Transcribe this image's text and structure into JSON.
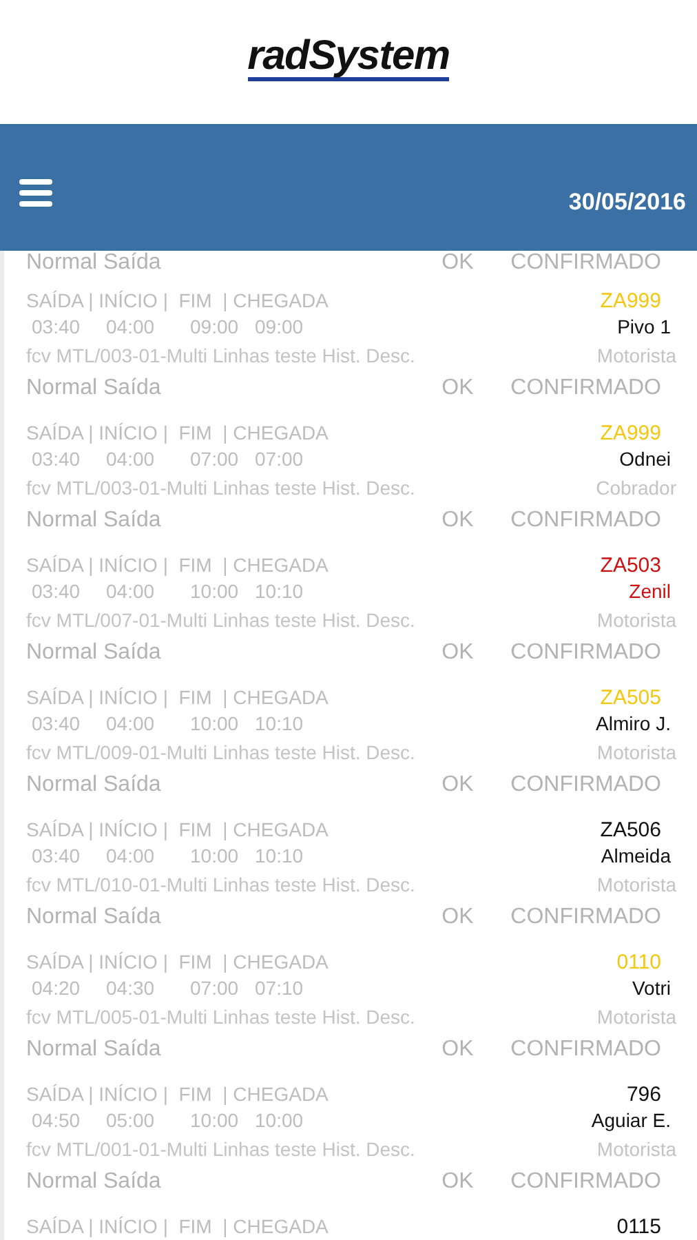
{
  "logo": {
    "text": "radSystem"
  },
  "toolbar": {
    "date": "30/05/2016"
  },
  "trips": [
    {
      "status": "Normal Saída",
      "result": "OK",
      "confirmation": "CONFIRMADO"
    },
    {
      "header": "SAÍDA | INÍCIO |  FIM  | CHEGADA",
      "code": "ZA999",
      "color": "#f2c811",
      "times": [
        "03:40",
        "04:00",
        "09:00",
        "09:00"
      ],
      "name": "Pivo 1",
      "line": "fcv MTL/003-01-Multi Linhas teste Hist. Desc.",
      "role": "Motorista",
      "status": "Normal Saída",
      "result": "OK",
      "confirmation": "CONFIRMADO"
    },
    {
      "header": "SAÍDA | INÍCIO |  FIM  | CHEGADA",
      "code": "ZA999",
      "color": "#f2c811",
      "times": [
        "03:40",
        "04:00",
        "07:00",
        "07:00"
      ],
      "name": "Odnei",
      "line": "fcv MTL/003-01-Multi Linhas teste Hist. Desc.",
      "role": "Cobrador",
      "status": "Normal Saída",
      "result": "OK",
      "confirmation": "CONFIRMADO"
    },
    {
      "header": "SAÍDA | INÍCIO |  FIM  | CHEGADA",
      "code": "ZA503",
      "color": "#cc1111",
      "times": [
        "03:40",
        "04:00",
        "10:00",
        "10:10"
      ],
      "name": "Zenil",
      "crew": {
        "color": "#cc1111"
      },
      "line": "fcv MTL/007-01-Multi Linhas teste Hist. Desc.",
      "role": "Motorista",
      "status": "Normal Saída",
      "result": "OK",
      "confirmation": "CONFIRMADO"
    },
    {
      "header": "SAÍDA | INÍCIO |  FIM  | CHEGADA",
      "code": "ZA505",
      "color": "#f2c811",
      "times": [
        "03:40",
        "04:00",
        "10:00",
        "10:10"
      ],
      "name": "Almiro J.",
      "line": "fcv MTL/009-01-Multi Linhas teste Hist. Desc.",
      "role": "Motorista",
      "status": "Normal Saída",
      "result": "OK",
      "confirmation": "CONFIRMADO"
    },
    {
      "header": "SAÍDA | INÍCIO |  FIM  | CHEGADA",
      "code": "ZA506",
      "color": "#111111",
      "times": [
        "03:40",
        "04:00",
        "10:00",
        "10:10"
      ],
      "name": "Almeida",
      "line": "fcv MTL/010-01-Multi Linhas teste Hist. Desc.",
      "role": "Motorista",
      "status": "Normal Saída",
      "result": "OK",
      "confirmation": "CONFIRMADO"
    },
    {
      "header": "SAÍDA | INÍCIO |  FIM  | CHEGADA",
      "code": "0110",
      "color": "#f2c811",
      "times": [
        "04:20",
        "04:30",
        "07:00",
        "07:10"
      ],
      "name": "Votri",
      "line": "fcv MTL/005-01-Multi Linhas teste Hist. Desc.",
      "role": "Motorista",
      "status": "Normal Saída",
      "result": "OK",
      "confirmation": "CONFIRMADO"
    },
    {
      "header": "SAÍDA | INÍCIO |  FIM  | CHEGADA",
      "code": "796",
      "color": "#111111",
      "times": [
        "04:50",
        "05:00",
        "10:00",
        "10:00"
      ],
      "name": "Aguiar E.",
      "line": "fcv MTL/001-01-Multi Linhas teste Hist. Desc.",
      "role": "Motorista",
      "status": "Normal Saída",
      "result": "OK",
      "confirmation": "CONFIRMADO"
    },
    {
      "header": "SAÍDA | INÍCIO |  FIM  | CHEGADA",
      "code": "0115",
      "color": "#111111"
    }
  ]
}
